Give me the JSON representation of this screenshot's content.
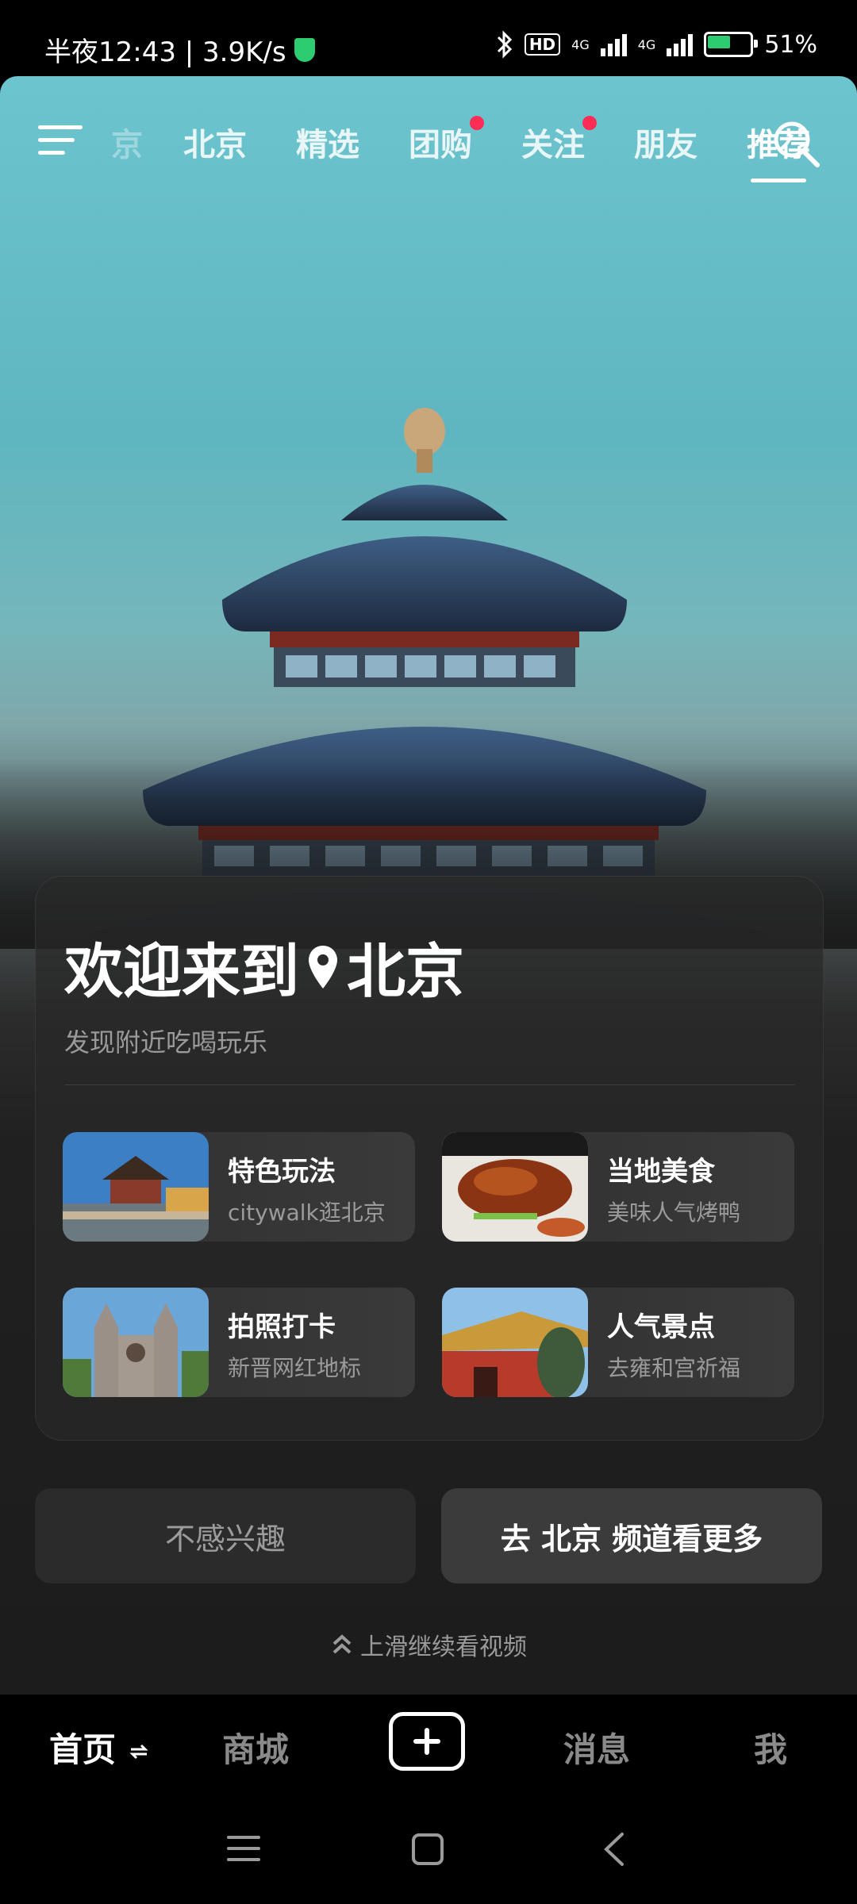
{
  "status_bar": {
    "time": "半夜12:43 | 3.9K/s",
    "network": "4G",
    "hd": "HD",
    "battery": "51%"
  },
  "top_nav": {
    "faded_tab": "京",
    "tabs": [
      {
        "label": "北京",
        "dot": false
      },
      {
        "label": "精选",
        "dot": false
      },
      {
        "label": "团购",
        "dot": true
      },
      {
        "label": "关注",
        "dot": true
      },
      {
        "label": "朋友",
        "dot": false
      },
      {
        "label": "推荐",
        "dot": false,
        "active": true
      }
    ]
  },
  "welcome": {
    "title_prefix": "欢迎来到",
    "city": "北京",
    "subtitle": "发现附近吃喝玩乐",
    "features": [
      {
        "title": "特色玩法",
        "subtitle": "citywalk逛北京",
        "icon": "corner-tower-photo"
      },
      {
        "title": "当地美食",
        "subtitle": "美味人气烤鸭",
        "icon": "roast-duck-photo"
      },
      {
        "title": "拍照打卡",
        "subtitle": "新晋网红地标",
        "icon": "church-photo"
      },
      {
        "title": "人气景点",
        "subtitle": "去雍和宫祈福",
        "icon": "temple-photo"
      }
    ]
  },
  "actions": {
    "not_interested": "不感兴趣",
    "go_channel": "去 北京 频道看更多",
    "swipe_hint": "上滑继续看视频"
  },
  "bottom_nav": {
    "home": "首页",
    "mall": "商城",
    "messages": "消息",
    "me": "我"
  },
  "colors": {
    "accent_dot": "#ff2d55",
    "sky": "#6cc4cf",
    "background": "#1c1c1c"
  }
}
